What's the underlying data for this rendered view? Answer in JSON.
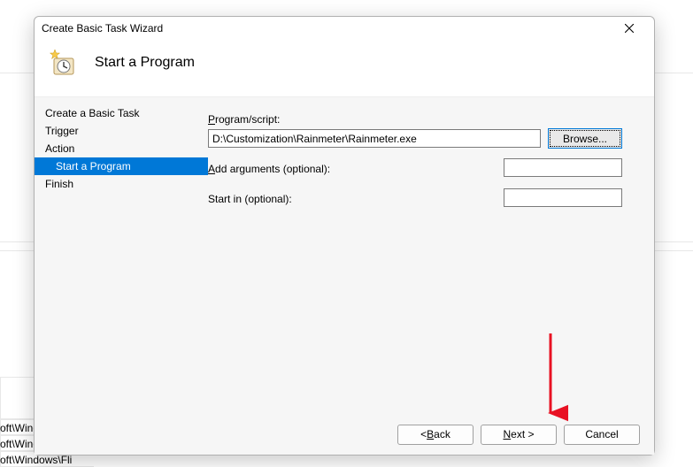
{
  "bg": {
    "item1": "oft\\Wind…",
    "item2": "oft\\Windows\\U…",
    "item3": "oft\\Windows\\Fli"
  },
  "dialog": {
    "title": "Create Basic Task Wizard",
    "heading": "Start a Program"
  },
  "sidebar": {
    "items": [
      {
        "label": "Create a Basic Task",
        "selected": false,
        "indent": false
      },
      {
        "label": "Trigger",
        "selected": false,
        "indent": false
      },
      {
        "label": "Action",
        "selected": false,
        "indent": false
      },
      {
        "label": "Start a Program",
        "selected": true,
        "indent": true
      },
      {
        "label": "Finish",
        "selected": false,
        "indent": false
      }
    ]
  },
  "form": {
    "program_label_pre": "P",
    "program_label_post": "rogram/script:",
    "program_value": "D:\\Customization\\Rainmeter\\Rainmeter.exe",
    "browse_label_pre": "B",
    "browse_label_post": "rowse...",
    "args_label_pre": "A",
    "args_label_post": "dd arguments (optional):",
    "args_value": "",
    "startin_label": "Start in (optional):",
    "startin_value": ""
  },
  "buttons": {
    "back_pre": "< ",
    "back_ul": "B",
    "back_post": "ack",
    "next_ul": "N",
    "next_post": "ext >",
    "cancel": "Cancel"
  }
}
